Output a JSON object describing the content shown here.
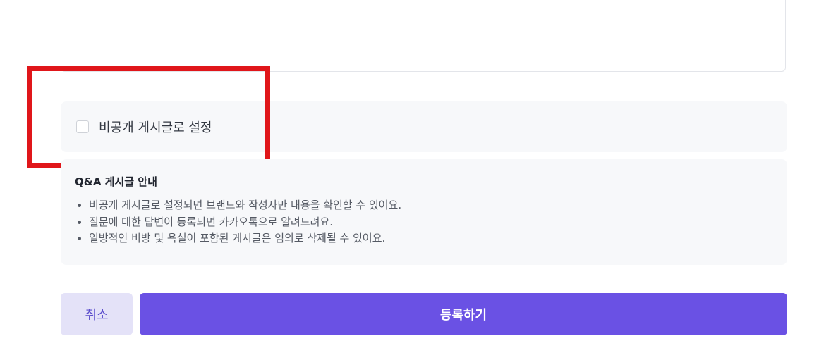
{
  "form": {
    "content_textarea_value": ""
  },
  "private_option": {
    "label": "비공개 게시글로 설정",
    "checked": false
  },
  "notice": {
    "title": "Q&A 게시글 안내",
    "items": [
      "비공개 게시글로 설정되면 브랜드와 작성자만 내용을 확인할 수 있어요.",
      "질문에 대한 답변이 등록되면 카카오톡으로 알려드려요.",
      "일방적인 비방 및 욕설이 포함된 게시글은 임의로 삭제될 수 있어요."
    ]
  },
  "actions": {
    "cancel_label": "취소",
    "submit_label": "등록하기"
  },
  "colors": {
    "primary": "#6a51e4",
    "cancel_bg": "#e4e2f8",
    "cancel_text": "#5a4ccc",
    "highlight": "#e0161a",
    "panel_bg": "#f7f8fa"
  }
}
